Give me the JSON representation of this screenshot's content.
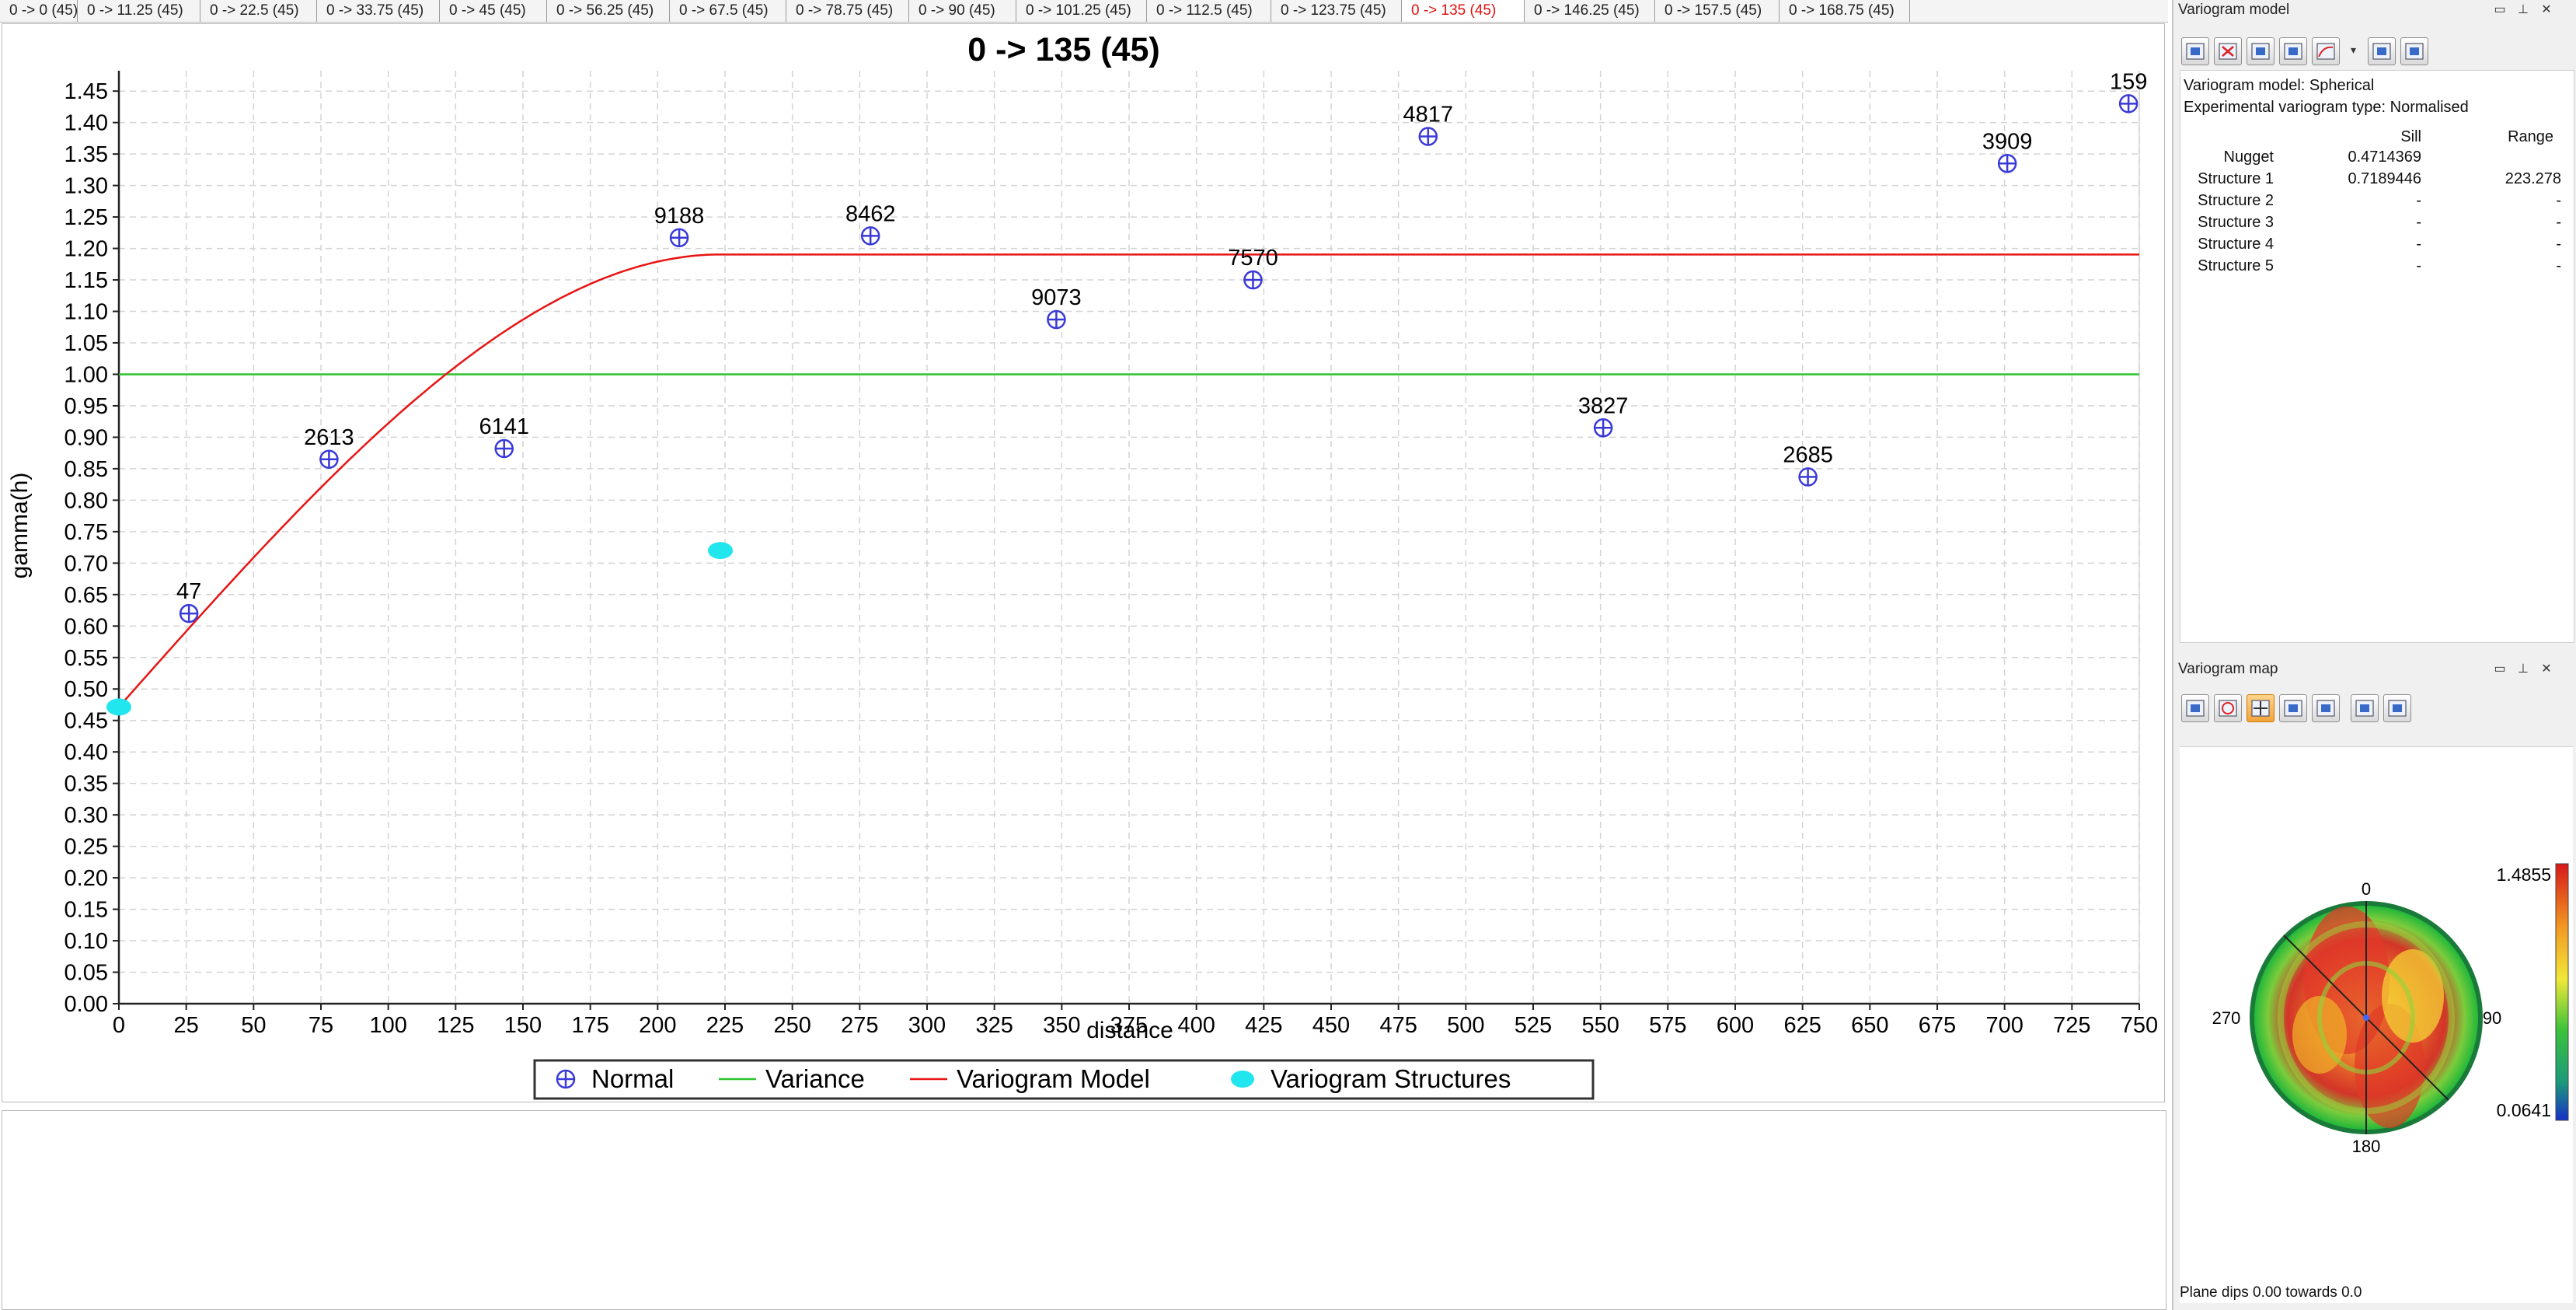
{
  "tabs": [
    {
      "label": "0 -> 0 (45)",
      "width": 100
    },
    {
      "label": "0 -> 11.25 (45)",
      "width": 158
    },
    {
      "label": "0 -> 22.5 (45)",
      "width": 150
    },
    {
      "label": "0 -> 33.75 (45)",
      "width": 158
    },
    {
      "label": "0 -> 45 (45)",
      "width": 138
    },
    {
      "label": "0 -> 56.25 (45)",
      "width": 158
    },
    {
      "label": "0 -> 67.5 (45)",
      "width": 150
    },
    {
      "label": "0 -> 78.75 (45)",
      "width": 158
    },
    {
      "label": "0 -> 90 (45)",
      "width": 138
    },
    {
      "label": "0 -> 101.25 (45)",
      "width": 168
    },
    {
      "label": "0 -> 112.5 (45)",
      "width": 160
    },
    {
      "label": "0 -> 123.75 (45)",
      "width": 168
    },
    {
      "label": "0 -> 135 (45)",
      "width": 158,
      "active": true
    },
    {
      "label": "0 -> 146.25 (45)",
      "width": 168
    },
    {
      "label": "0 -> 157.5 (45)",
      "width": 160
    },
    {
      "label": "0 -> 168.75 (45)",
      "width": 168
    }
  ],
  "chart_data": {
    "type": "scatter",
    "title": "0 -> 135 (45)",
    "xlabel": "distance",
    "ylabel": "gamma(h)",
    "xlim": [
      0,
      750
    ],
    "ylim": [
      0,
      1.47
    ],
    "xticks": [
      0,
      25,
      50,
      75,
      100,
      125,
      150,
      175,
      200,
      225,
      250,
      275,
      300,
      325,
      350,
      375,
      400,
      425,
      450,
      475,
      500,
      525,
      550,
      575,
      600,
      625,
      650,
      675,
      700,
      725,
      750
    ],
    "yticks": [
      "0.00",
      "0.05",
      "0.10",
      "0.15",
      "0.20",
      "0.25",
      "0.30",
      "0.35",
      "0.40",
      "0.45",
      "0.50",
      "0.55",
      "0.60",
      "0.65",
      "0.70",
      "0.75",
      "0.80",
      "0.85",
      "0.90",
      "0.95",
      "1.00",
      "1.05",
      "1.10",
      "1.15",
      "1.20",
      "1.25",
      "1.30",
      "1.35",
      "1.40",
      "1.45"
    ],
    "grid": true,
    "legend_position": "bottom",
    "series": [
      {
        "name": "Normal",
        "color": "#3a3ad8",
        "points": [
          {
            "x": 26,
            "y": 0.62,
            "label": "47"
          },
          {
            "x": 78,
            "y": 0.865,
            "label": "2613"
          },
          {
            "x": 143,
            "y": 0.882,
            "label": "6141"
          },
          {
            "x": 208,
            "y": 1.217,
            "label": "9188"
          },
          {
            "x": 279,
            "y": 1.22,
            "label": "8462"
          },
          {
            "x": 348,
            "y": 1.087,
            "label": "9073"
          },
          {
            "x": 421,
            "y": 1.15,
            "label": "7570"
          },
          {
            "x": 486,
            "y": 1.378,
            "label": "4817"
          },
          {
            "x": 551,
            "y": 0.915,
            "label": "3827"
          },
          {
            "x": 627,
            "y": 0.837,
            "label": "2685"
          },
          {
            "x": 701,
            "y": 1.335,
            "label": "3909"
          },
          {
            "x": 746,
            "y": 1.43,
            "label": "159"
          }
        ]
      },
      {
        "name": "Variance",
        "color": "#2ec42e",
        "y": 1.0
      },
      {
        "name": "Variogram Model",
        "color": "#e81414",
        "nugget": 0.4714369,
        "sill": 0.7189446,
        "range": 223.278
      },
      {
        "name": "Variogram Structures",
        "color": "#22e6ee",
        "points": [
          {
            "x": 0,
            "y": 0.4714369
          },
          {
            "x": 223.278,
            "y": 0.72
          }
        ]
      }
    ]
  },
  "variogram_model_panel": {
    "title": "Variogram model",
    "model_line": "Variogram model: Spherical",
    "exp_type_line": "Experimental variogram type: Normalised",
    "col_sill": "Sill",
    "col_range": "Range",
    "rows": [
      {
        "label": "Nugget",
        "sill": "0.4714369",
        "range": ""
      },
      {
        "label": "Structure 1",
        "sill": "0.7189446",
        "range": "223.278"
      },
      {
        "label": "Structure 2",
        "sill": "-",
        "range": "-"
      },
      {
        "label": "Structure 3",
        "sill": "-",
        "range": "-"
      },
      {
        "label": "Structure 4",
        "sill": "-",
        "range": "-"
      },
      {
        "label": "Structure 5",
        "sill": "-",
        "range": "-"
      }
    ],
    "toolbar_icons": [
      "load-model-icon",
      "delete-model-icon",
      "import-model-icon",
      "export-model-icon",
      "fit-curve-icon",
      "dropdown-icon",
      "copy-to-other-icon",
      "chart-options-icon"
    ]
  },
  "variogram_map_panel": {
    "title": "Variogram map",
    "toolbar_icons": [
      "reset-view-icon",
      "rotate-icon",
      "pan-axis-icon",
      "align-axis-icon",
      "link-icon",
      "zoom-in-icon",
      "zoom-out-icon"
    ],
    "compass": {
      "north": "0",
      "east": "90",
      "south": "180",
      "west": "270"
    },
    "colorbar_max": "1.4855",
    "colorbar_min": "0.0641",
    "plane_dips": "Plane dips  0.00 towards   0.0"
  }
}
